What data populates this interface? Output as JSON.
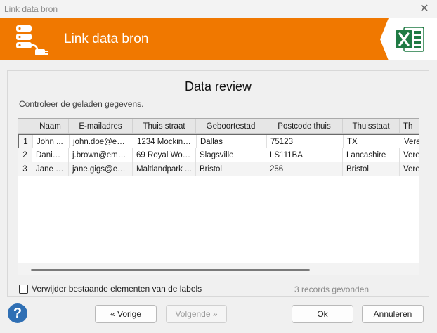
{
  "window": {
    "title": "Link data bron",
    "close_glyph": "✕"
  },
  "banner": {
    "heading": "Link data bron",
    "logo_icon": "database-plug-icon",
    "excel_icon": "excel-icon",
    "color": "#f07800"
  },
  "review": {
    "title": "Data review",
    "subtitle": "Controleer de geladen gegevens."
  },
  "grid": {
    "columns": [
      "Naam",
      "E-mailadres",
      "Thuis straat",
      "Geboortestad",
      "Postcode thuis",
      "Thuisstaat",
      "Th"
    ],
    "rows": [
      {
        "index": "1",
        "cells": [
          "John ...",
          "john.doe@em...",
          "1234 Mocking...",
          "Dallas",
          "75123",
          "TX",
          "Vere"
        ]
      },
      {
        "index": "2",
        "cells": [
          "Daniel...",
          "j.brown@ema...",
          "69 Royal Worc...",
          "Slagsville",
          "LS111BA",
          "Lancashire",
          "Vere"
        ]
      },
      {
        "index": "3",
        "cells": [
          "Jane G...",
          "jane.gigs@em...",
          "Maltlandpark ...",
          "Bristol",
          "256",
          "Bristol",
          "Vere"
        ]
      }
    ]
  },
  "options": {
    "remove_existing_label": "Verwijder bestaande elementen van de labels",
    "remove_existing_checked": false
  },
  "status": {
    "records": "3 records gevonden"
  },
  "buttons": {
    "help": "?",
    "previous": "« Vorige",
    "next": "Volgende »",
    "ok": "Ok",
    "cancel": "Annuleren"
  }
}
